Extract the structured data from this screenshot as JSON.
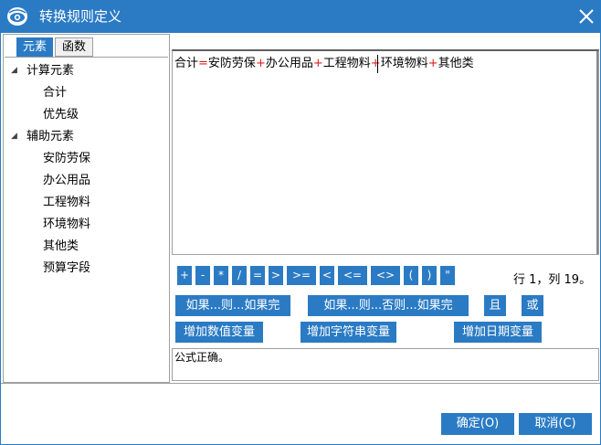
{
  "window": {
    "title": "转换规则定义",
    "accent": "#2b7bc4"
  },
  "icons": {
    "app": "app-eye-icon",
    "close": "close-icon",
    "expand": "tree-expanded-arrow-icon"
  },
  "left_panel": {
    "tabs": [
      {
        "label": "元素",
        "active": true
      },
      {
        "label": "函数",
        "active": false
      }
    ],
    "tree": [
      {
        "label": "计算元素",
        "expanded": true,
        "children": [
          "合计",
          "优先级"
        ]
      },
      {
        "label": "辅助元素",
        "expanded": true,
        "children": [
          "安防劳保",
          "办公用品",
          "工程物料",
          "环境物料",
          "其他类",
          "预算字段"
        ]
      }
    ]
  },
  "editor": {
    "formula_tokens": [
      {
        "text": "合计",
        "op": false
      },
      {
        "text": "=",
        "op": true
      },
      {
        "text": "安防劳保",
        "op": false
      },
      {
        "text": "+",
        "op": true
      },
      {
        "text": "办公用品",
        "op": false
      },
      {
        "text": "+",
        "op": true
      },
      {
        "text": "工程物料",
        "op": false
      },
      {
        "text": "+",
        "op": true
      },
      {
        "text": "环境物料",
        "op": false
      },
      {
        "text": "+",
        "op": true
      },
      {
        "text": "其他类",
        "op": false
      }
    ],
    "operator_color": "#e0201a"
  },
  "operators": [
    "+",
    "-",
    "*",
    "/",
    "=",
    ">",
    ">=",
    "<",
    "<=",
    "<>",
    "(",
    ")",
    "\""
  ],
  "cursor_position": "行 1，列 19。",
  "commands": {
    "if_then": "如果...则...如果完",
    "if_then_else": "如果...则...否则...如果完",
    "and": "且",
    "or": "或",
    "add_numeric": "增加数值变量",
    "add_string": "增加字符串变量",
    "add_date": "增加日期变量"
  },
  "status": {
    "message": "公式正确。"
  },
  "footer": {
    "ok": "确定(O)",
    "cancel": "取消(C)"
  }
}
